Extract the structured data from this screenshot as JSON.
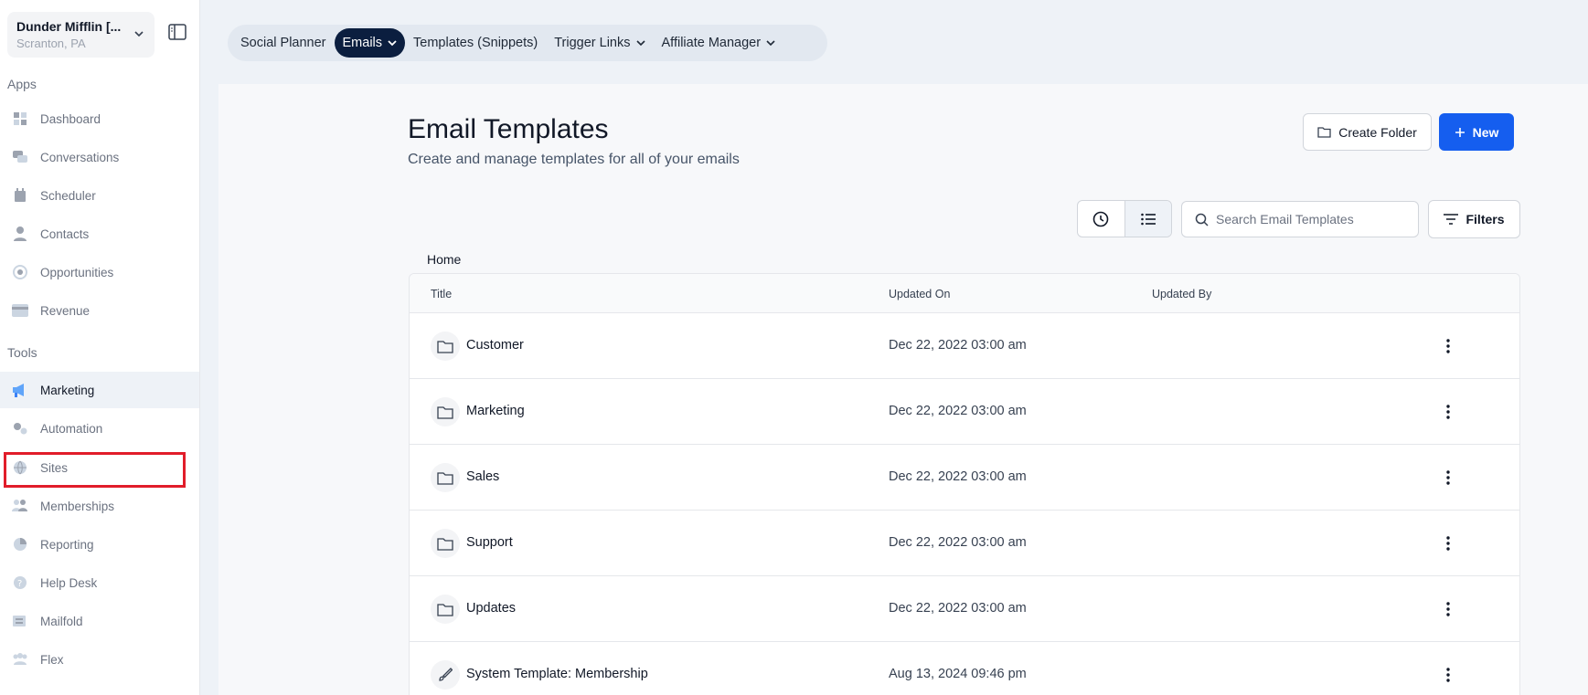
{
  "location": {
    "name": "Dunder Mifflin [...",
    "city": "Scranton, PA"
  },
  "sidebar": {
    "apps_label": "Apps",
    "apps": [
      {
        "label": "Dashboard",
        "icon": "dashboard-icon"
      },
      {
        "label": "Conversations",
        "icon": "chat-icon"
      },
      {
        "label": "Scheduler",
        "icon": "calendar-icon"
      },
      {
        "label": "Contacts",
        "icon": "person-icon"
      },
      {
        "label": "Opportunities",
        "icon": "target-icon"
      },
      {
        "label": "Revenue",
        "icon": "card-icon"
      }
    ],
    "tools_label": "Tools",
    "tools": [
      {
        "label": "Marketing",
        "icon": "megaphone-icon",
        "active": true
      },
      {
        "label": "Automation",
        "icon": "gears-icon"
      },
      {
        "label": "Sites",
        "icon": "globe-icon"
      },
      {
        "label": "Memberships",
        "icon": "members-icon"
      },
      {
        "label": "Reporting",
        "icon": "pie-icon"
      },
      {
        "label": "Help Desk",
        "icon": "help-icon"
      },
      {
        "label": "Mailfold",
        "icon": "mailfold-icon"
      },
      {
        "label": "Flex",
        "icon": "people-icon"
      }
    ]
  },
  "topnav": {
    "items": [
      {
        "label": "Social Planner",
        "dropdown": false
      },
      {
        "label": "Emails",
        "dropdown": true,
        "active": true
      },
      {
        "label": "Templates (Snippets)",
        "dropdown": false
      },
      {
        "label": "Trigger Links",
        "dropdown": true
      },
      {
        "label": "Affiliate Manager",
        "dropdown": true
      }
    ]
  },
  "page": {
    "title": "Email Templates",
    "subtitle": "Create and manage templates for all of your emails",
    "create_folder": "Create Folder",
    "new": "New",
    "search_placeholder": "Search Email Templates",
    "filters": "Filters",
    "breadcrumb": "Home"
  },
  "table": {
    "headers": {
      "title": "Title",
      "updated_on": "Updated On",
      "updated_by": "Updated By"
    },
    "rows": [
      {
        "title": "Customer",
        "updated_on": "Dec 22, 2022 03:00 am",
        "updated_by": "",
        "type": "folder"
      },
      {
        "title": "Marketing",
        "updated_on": "Dec 22, 2022 03:00 am",
        "updated_by": "",
        "type": "folder"
      },
      {
        "title": "Sales",
        "updated_on": "Dec 22, 2022 03:00 am",
        "updated_by": "",
        "type": "folder"
      },
      {
        "title": "Support",
        "updated_on": "Dec 22, 2022 03:00 am",
        "updated_by": "",
        "type": "folder"
      },
      {
        "title": "Updates",
        "updated_on": "Dec 22, 2022 03:00 am",
        "updated_by": "",
        "type": "folder"
      },
      {
        "title": "System Template: Membership",
        "updated_on": "Aug 13, 2024 09:46 pm",
        "updated_by": "",
        "type": "template"
      }
    ]
  },
  "colors": {
    "accent": "#155eef",
    "nav_active": "#0b1e3f",
    "highlight": "#e11d2a"
  }
}
